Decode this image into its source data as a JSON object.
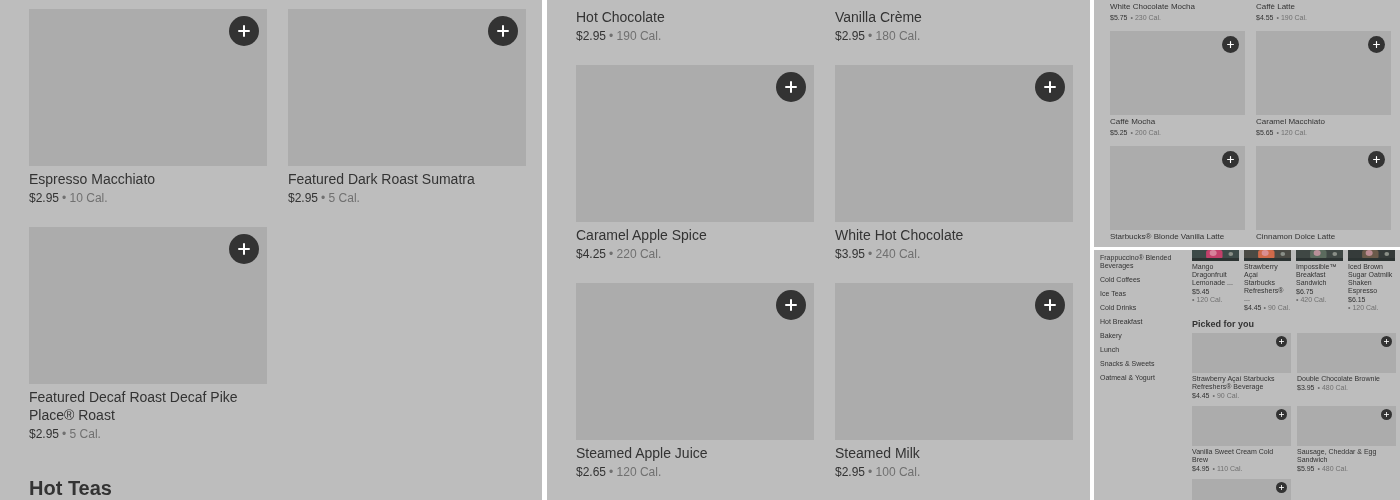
{
  "panels": [
    {
      "kind": "large",
      "items": [
        {
          "name": "Espresso Macchiato",
          "price": "$2.95",
          "calories": "• 10 Cal.",
          "image": true
        },
        {
          "name": "Featured Dark Roast Sumatra",
          "price": "$2.95",
          "calories": "• 5 Cal.",
          "image": true
        },
        {
          "name": "Featured Decaf Roast Decaf Pike Place® Roast",
          "price": "$2.95",
          "calories": "• 5 Cal.",
          "image": true
        }
      ],
      "section_heading": "Hot Teas"
    },
    {
      "kind": "large",
      "items": [
        {
          "name": "Hot Chocolate",
          "price": "$2.95",
          "calories": "• 190 Cal.",
          "image": false
        },
        {
          "name": "Vanilla Crème",
          "price": "$2.95",
          "calories": "• 180 Cal.",
          "image": false
        },
        {
          "name": "Caramel Apple Spice",
          "price": "$4.25",
          "calories": "• 220 Cal.",
          "image": true
        },
        {
          "name": "White Hot Chocolate",
          "price": "$3.95",
          "calories": "• 240 Cal.",
          "image": true
        },
        {
          "name": "Steamed Apple Juice",
          "price": "$2.65",
          "calories": "• 120 Cal.",
          "image": true
        },
        {
          "name": "Steamed Milk",
          "price": "$2.95",
          "calories": "• 100 Cal.",
          "image": true
        }
      ]
    },
    {
      "kind": "small",
      "items": [
        {
          "name": "White Chocolate Mocha",
          "price": "$5.75",
          "calories": "• 230 Cal.",
          "image": false
        },
        {
          "name": "Caffè Latte",
          "price": "$4.55",
          "calories": "• 190 Cal.",
          "image": false
        },
        {
          "name": "Caffè Mocha",
          "price": "$5.25",
          "calories": "• 200 Cal.",
          "image": true
        },
        {
          "name": "Caramel Macchiato",
          "price": "$5.65",
          "calories": "• 120 Cal.",
          "image": true
        },
        {
          "name": "Starbucks® Blonde Vanilla Latte",
          "image": true
        },
        {
          "name": "Cinnamon Dolce Latte",
          "image": true
        }
      ]
    },
    {
      "kind": "store",
      "categories": [
        "Frappuccino® Blended Beverages",
        "Cold Coffees",
        "Ice Teas",
        "Cold Drinks",
        "Hot Breakfast",
        "Bakery",
        "Lunch",
        "Snacks & Sweets",
        "Oatmeal & Yogurt"
      ],
      "carousel": [
        {
          "name": "Mango Dragonfruit Lemonade ...",
          "price": "$5.45",
          "calories": "• 120 Cal."
        },
        {
          "name": "Strawberry Açaí Starbucks Refreshers® ...",
          "price": "$4.45",
          "calories": "• 90 Cal."
        },
        {
          "name": "Impossible™ Breakfast Sandwich",
          "price": "$6.75",
          "calories": "• 420 Cal."
        },
        {
          "name": "Iced Brown Sugar Oatmilk Shaken Espresso",
          "price": "$6.15",
          "calories": "• 120 Cal."
        }
      ],
      "section_heading": "Picked for you",
      "items": [
        {
          "name": "Strawberry Açaí Starbucks Refreshers® Beverage",
          "price": "$4.45",
          "calories": "• 90 Cal.",
          "image": true
        },
        {
          "name": "Double Chocolate Brownie",
          "price": "$3.95",
          "calories": "• 480 Cal.",
          "image": true
        },
        {
          "name": "Vanilla Sweet Cream Cold Brew",
          "price": "$4.95",
          "calories": "• 110 Cal.",
          "image": true
        },
        {
          "name": "Sausage, Cheddar & Egg Sandwich",
          "price": "$5.95",
          "calories": "• 480 Cal.",
          "image": true
        },
        {
          "image": true
        }
      ]
    }
  ]
}
